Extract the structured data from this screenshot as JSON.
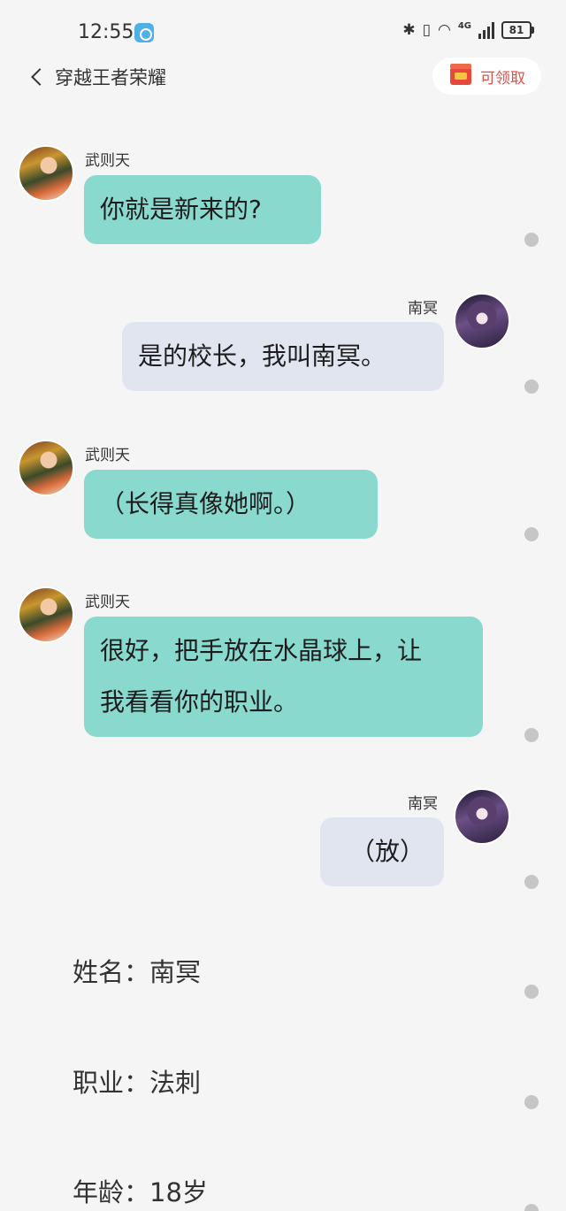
{
  "status_bar": {
    "time": "12:55",
    "network": "4G",
    "battery": "81"
  },
  "header": {
    "back_icon": "chevron-left-icon",
    "title": "穿越王者荣耀",
    "claim_icon": "red-gift-icon",
    "claim_label": "可领取"
  },
  "messages": [
    {
      "sender": "武则天",
      "text": "你就是新来的?"
    },
    {
      "sender": "南冥",
      "text": "是的校长，我叫南冥。"
    },
    {
      "sender": "武则天",
      "text": "（长得真像她啊。）"
    },
    {
      "sender": "武则天",
      "line1": "很好，把手放在水晶球上，让",
      "line2": "我看看你的职业。"
    },
    {
      "sender": "南冥",
      "text": "（放）"
    }
  ],
  "narration": [
    "姓名：南冥",
    "职业：法刺",
    "年龄：18岁"
  ],
  "colors": {
    "background": "#f5f5f5",
    "left_bubble": "#8ad9cf",
    "right_bubble": "#e0e5ef",
    "claim_text": "#e0524a"
  }
}
